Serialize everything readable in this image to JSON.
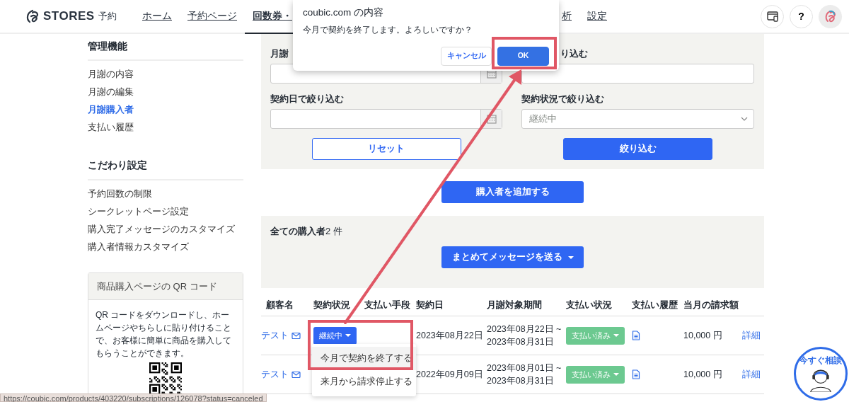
{
  "header": {
    "logo": "STORES",
    "logo_suffix": "予約",
    "nav": [
      {
        "label": "ホーム",
        "selected": false
      },
      {
        "label": "予約ページ",
        "selected": false
      },
      {
        "label": "回数券・",
        "selected": true
      },
      {
        "label": "析",
        "selected": false
      },
      {
        "label": "設定",
        "selected": false
      }
    ],
    "help": "?"
  },
  "sidebar": {
    "sections": [
      {
        "title": "管理機能",
        "items": [
          {
            "label": "月謝の内容",
            "selected": false
          },
          {
            "label": "月謝の編集",
            "selected": false
          },
          {
            "label": "月謝購入者",
            "selected": true
          },
          {
            "label": "支払い履歴",
            "selected": false
          }
        ]
      },
      {
        "title": "こだわり設定",
        "items": [
          {
            "label": "予約回数の制限",
            "selected": false
          },
          {
            "label": "シークレットページ設定",
            "selected": false
          },
          {
            "label": "購入完了メッセージのカスタマイズ",
            "selected": false
          },
          {
            "label": "購入者情報カスタマイズ",
            "selected": false
          }
        ]
      }
    ],
    "qr_card": {
      "title": "商品購入ページの QR コード",
      "text": "QR コードをダウンロードし、ホームページやちらしに貼り付けることで、お客様に簡単に商品を購入してもらうことができます。"
    }
  },
  "filters": {
    "fields": [
      {
        "label": "月謝",
        "kind": "date"
      },
      {
        "label": "り込む",
        "kind": "text"
      },
      {
        "label": "契約日で絞り込む",
        "kind": "date"
      },
      {
        "label": "契約状況で絞り込む",
        "kind": "select",
        "value": "継続中"
      }
    ],
    "buttons": [
      {
        "label": "リセット",
        "kind": "outline"
      },
      {
        "label": "絞り込む",
        "kind": "primary"
      }
    ]
  },
  "add_button": "購入者を追加する",
  "summary": {
    "title": "全ての購入者",
    "count": "2 件",
    "message_button": "まとめてメッセージを送る"
  },
  "table": {
    "columns": [
      "顧客名",
      "契約状況",
      "支払い手段",
      "契約日",
      "月謝対象期間",
      "支払い状況",
      "支払い履歴",
      "当月の請求額"
    ],
    "rows": [
      {
        "customer": "テスト",
        "status": "継続中",
        "contract_date": "2023年08月22日",
        "period": [
          "2023年08月22日 ~",
          "2023年08月31日"
        ],
        "payment_status": "支払い済み",
        "amount": "10,000 円",
        "link": "詳細"
      },
      {
        "customer": "テスト",
        "contract_date": "2022年09月09日",
        "period": [
          "2023年08月01日 ~",
          "2023年08月31日"
        ],
        "payment_status": "支払い済み",
        "amount": "10,000 円",
        "link": "詳細"
      }
    ]
  },
  "status_menu": {
    "items": [
      {
        "label": "今月で契約を終了する",
        "selected": true
      },
      {
        "label": "来月から請求停止する",
        "selected": false
      }
    ]
  },
  "dialog": {
    "title": "coubic.com の内容",
    "message": "今月で契約を終了します。よろしいですか？",
    "buttons": [
      {
        "label": "キャンセル",
        "kind": "secondary"
      },
      {
        "label": "OK",
        "kind": "primary"
      }
    ]
  },
  "status_bar": "https://coubic.com/products/403220/subscriptions/126078?status=canceled",
  "chat_button": "今すぐ相談"
}
